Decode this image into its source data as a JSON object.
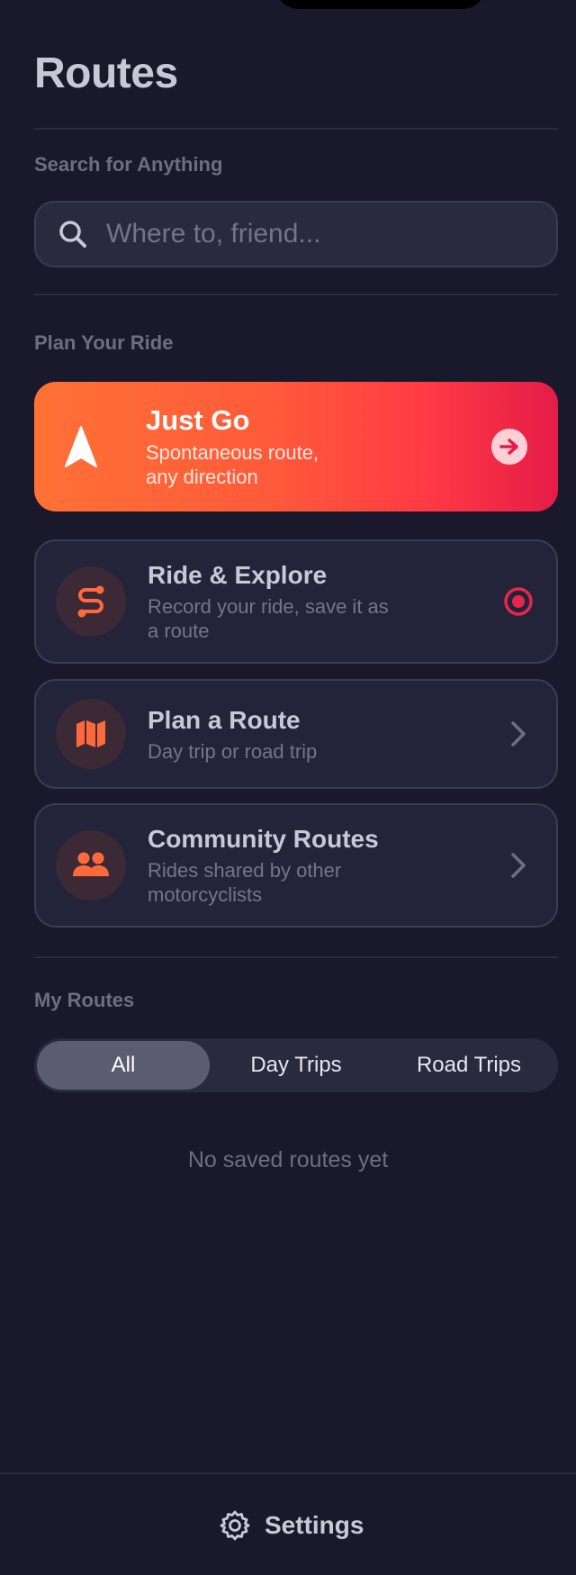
{
  "header": {
    "title": "Routes"
  },
  "search": {
    "label": "Search for Anything",
    "placeholder": "Where to, friend...",
    "value": ""
  },
  "plan": {
    "label": "Plan Your Ride",
    "just_go": {
      "title": "Just Go",
      "subtitle": "Spontaneous route,\nany direction",
      "icon": "navigation-arrow-icon",
      "trailing_icon": "arrow-right-circle-icon"
    },
    "cards": [
      {
        "title": "Ride & Explore",
        "subtitle": "Record your ride, save it as\na route",
        "icon": "route-path-icon",
        "trailing_icon": "record-icon"
      },
      {
        "title": "Plan a Route",
        "subtitle": "Day trip or road trip",
        "icon": "map-icon",
        "trailing_icon": "chevron-right-icon"
      },
      {
        "title": "Community Routes",
        "subtitle": "Rides shared by other\nmotorcyclists",
        "icon": "people-icon",
        "trailing_icon": "chevron-right-icon"
      }
    ]
  },
  "my_routes": {
    "label": "My Routes",
    "filters": [
      {
        "label": "All",
        "selected": true
      },
      {
        "label": "Day Trips",
        "selected": false
      },
      {
        "label": "Road Trips",
        "selected": false
      }
    ],
    "empty_message": "No saved routes yet"
  },
  "footer": {
    "settings_label": "Settings",
    "icon": "gear-icon"
  },
  "colors": {
    "background": "#19192b",
    "accent": "#ff6a3d",
    "just_go_start": "#ff7135",
    "just_go_end": "#e41c48",
    "record": "#e8264b"
  }
}
